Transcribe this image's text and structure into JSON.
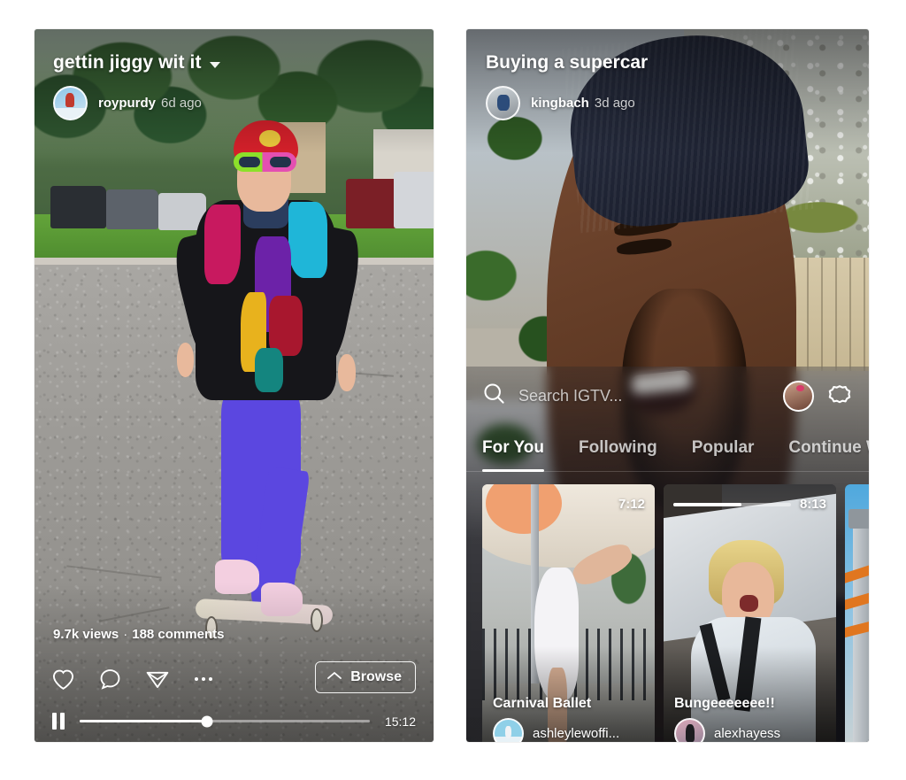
{
  "left_panel": {
    "video_title": "gettin jiggy wit it",
    "title_caret_icon": "chevron-down-icon",
    "username": "roypurdy",
    "timestamp": "6d ago",
    "stats": {
      "views": "9.7k views",
      "separator": "·",
      "comments": "188 comments"
    },
    "actions": {
      "like_icon": "heart-icon",
      "comment_icon": "comment-bubble-icon",
      "share_icon": "paper-plane-icon",
      "more_icon": "more-dots-icon"
    },
    "browse_button": {
      "label": "Browse",
      "icon": "chevron-up-icon"
    },
    "player": {
      "pause_icon": "pause-icon",
      "progress_percent": 44,
      "duration": "15:12"
    }
  },
  "right_panel": {
    "video_title": "Buying a supercar",
    "username": "kingbach",
    "timestamp": "3d ago",
    "search": {
      "icon": "search-icon",
      "placeholder": "Search IGTV...",
      "value": ""
    },
    "profile_avatar_icon": "profile-avatar-icon",
    "igtv_icon": "igtv-gear-icon",
    "tabs": [
      {
        "label": "For You",
        "active": true
      },
      {
        "label": "Following",
        "active": false
      },
      {
        "label": "Popular",
        "active": false
      },
      {
        "label": "Continue W",
        "active": false
      }
    ],
    "cards": [
      {
        "title": "Carnival Ballet",
        "username": "ashleylewoffi...",
        "duration": "7:12",
        "progress_percent": 0,
        "has_progress": false
      },
      {
        "title": "Bungeeeeeee!!",
        "username": "alexhayess",
        "duration": "8:13",
        "progress_percent": 58,
        "has_progress": true
      },
      {
        "title": "",
        "username": "",
        "duration": "",
        "progress_percent": 0,
        "has_progress": false
      }
    ]
  },
  "colors": {
    "page_background": "#ffffff",
    "overlay_text": "#ffffff",
    "accent_underline": "#ffffff"
  }
}
